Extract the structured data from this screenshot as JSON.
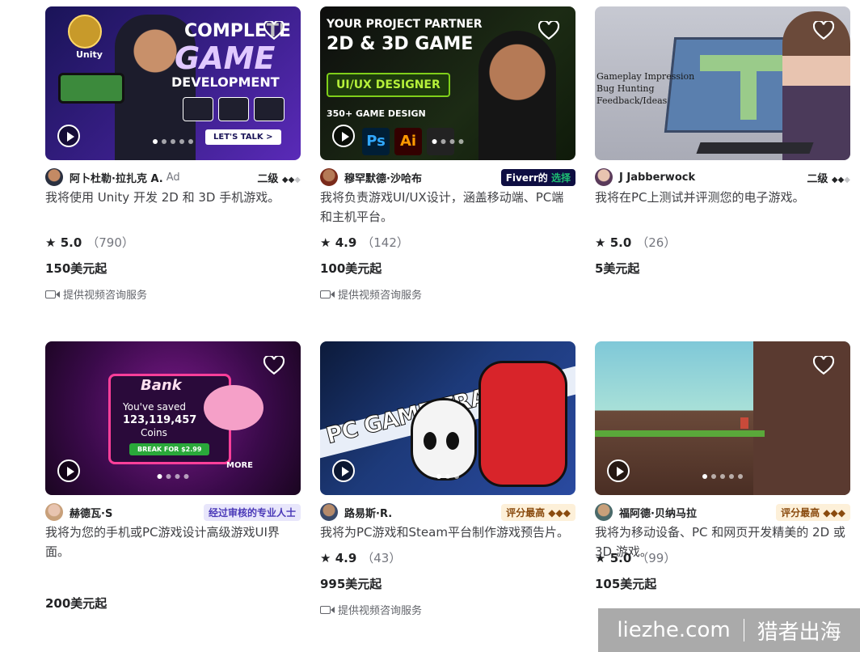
{
  "cards": [
    {
      "seller": "阿卜杜勒·拉扎克 A.",
      "ad": "Ad",
      "level": "二级",
      "title": "我将使用 Unity 开发 2D 和 3D 手机游戏。",
      "rating": "5.0",
      "reviews": "（790）",
      "price": "150美元起",
      "video": "提供视频咨询服务",
      "thumb_text": [
        "COMPLETE",
        "GAME",
        "DEVELOPMENT",
        "Unity",
        "LET'S TALK >"
      ]
    },
    {
      "seller": "穆罕默德·沙哈布",
      "badge_a": "Fiverr的",
      "badge_b": "选择",
      "title": "我将负责游戏UI/UX设计，涵盖移动端、PC端和主机平台。",
      "rating": "4.9",
      "reviews": "（142）",
      "price": "100美元起",
      "video": "提供视频咨询服务",
      "thumb_text": [
        "YOUR PROJECT PARTNER",
        "2D & 3D GAME",
        "UI/UX DESIGNER",
        "350+ GAME DESIGN",
        "Ps",
        "Ai"
      ]
    },
    {
      "seller": "J Jabberwock",
      "level": "二级",
      "title": "我将在PC上测试并评测您的电子游戏。",
      "rating": "5.0",
      "reviews": "（26）",
      "price": "5美元起",
      "thumb_text": [
        "Gameplay Impression",
        "Bug Hunting",
        "Feedback/Ideas"
      ]
    },
    {
      "seller": "赫德瓦·S",
      "badge": "经过审核的专业人士",
      "title": "我将为您的手机或PC游戏设计高级游戏UI界面。",
      "price": "200美元起",
      "thumb_text": [
        "Bank",
        "You've saved",
        "123,119,457",
        "Coins",
        "BREAK FOR $2.99",
        "MORE"
      ]
    },
    {
      "seller": "路易斯·R.",
      "badge": "评分最高 ◆◆◆",
      "title": "我将为PC游戏和Steam平台制作游戏预告片。",
      "rating": "4.9",
      "reviews": "（43）",
      "price": "995美元起",
      "video": "提供视频咨询服务",
      "thumb_text": [
        "PC GAME TRAILER"
      ]
    },
    {
      "seller": "福阿德·贝纳马拉",
      "badge": "评分最高 ◆◆◆",
      "title": "我将为移动设备、PC 和网页开发精美的 2D 或 3D 游戏。",
      "rating": "5.0",
      "reviews": "（99）",
      "price": "105美元起"
    }
  ],
  "watermark": {
    "domain": "liezhe.com",
    "brand": "猎者出海"
  },
  "colors": {
    "star": "#222325",
    "fiverr_choice_bg": "#0e0e42",
    "fiverr_green": "#1dbf73"
  }
}
